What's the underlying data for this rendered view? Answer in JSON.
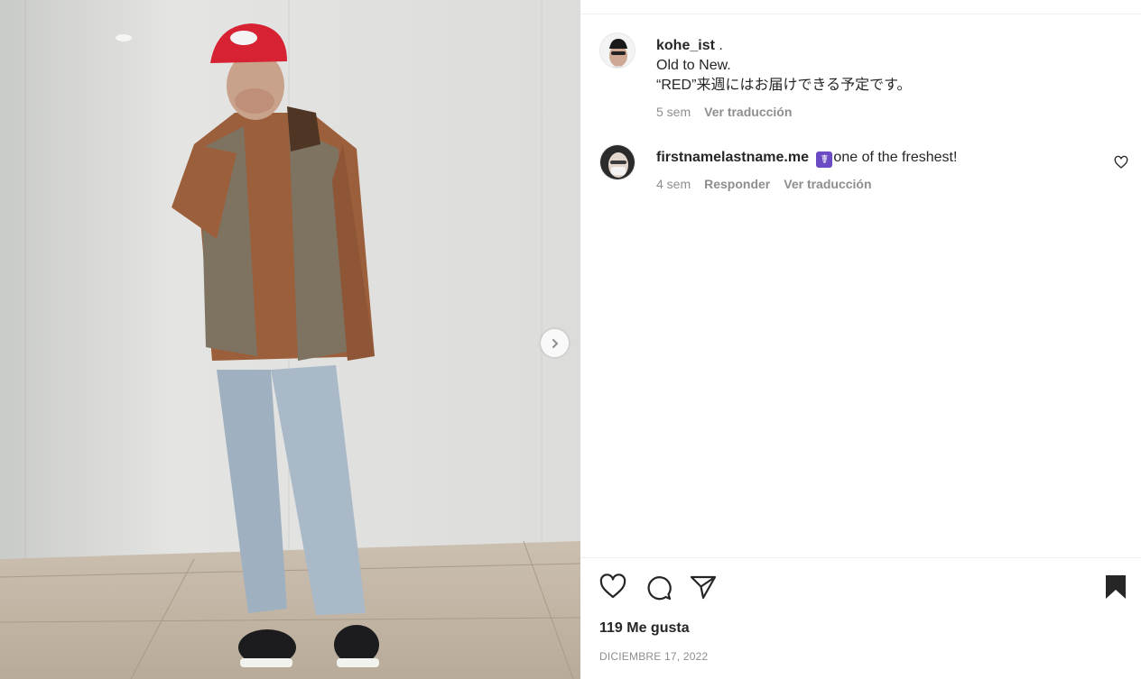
{
  "post": {
    "author": "kohe_ist",
    "caption_line1": "Old to New.",
    "caption_line2": "“RED”来週にはお届けできる予定です。",
    "time": "5 sem",
    "translate": "Ver traducción"
  },
  "comments": [
    {
      "username": "firstnamelastname.me",
      "emoji": "☤",
      "text": "one of the freshest!",
      "time": "4 sem",
      "reply": "Responder",
      "translate": "Ver traducción"
    }
  ],
  "footer": {
    "likes": "119 Me gusta",
    "date": "DICIEMBRE 17, 2022"
  },
  "icons": {
    "like": "heart-icon",
    "comment": "comment-icon",
    "share": "paper-plane-icon",
    "save": "bookmark-icon",
    "next": "chevron-right-icon"
  }
}
